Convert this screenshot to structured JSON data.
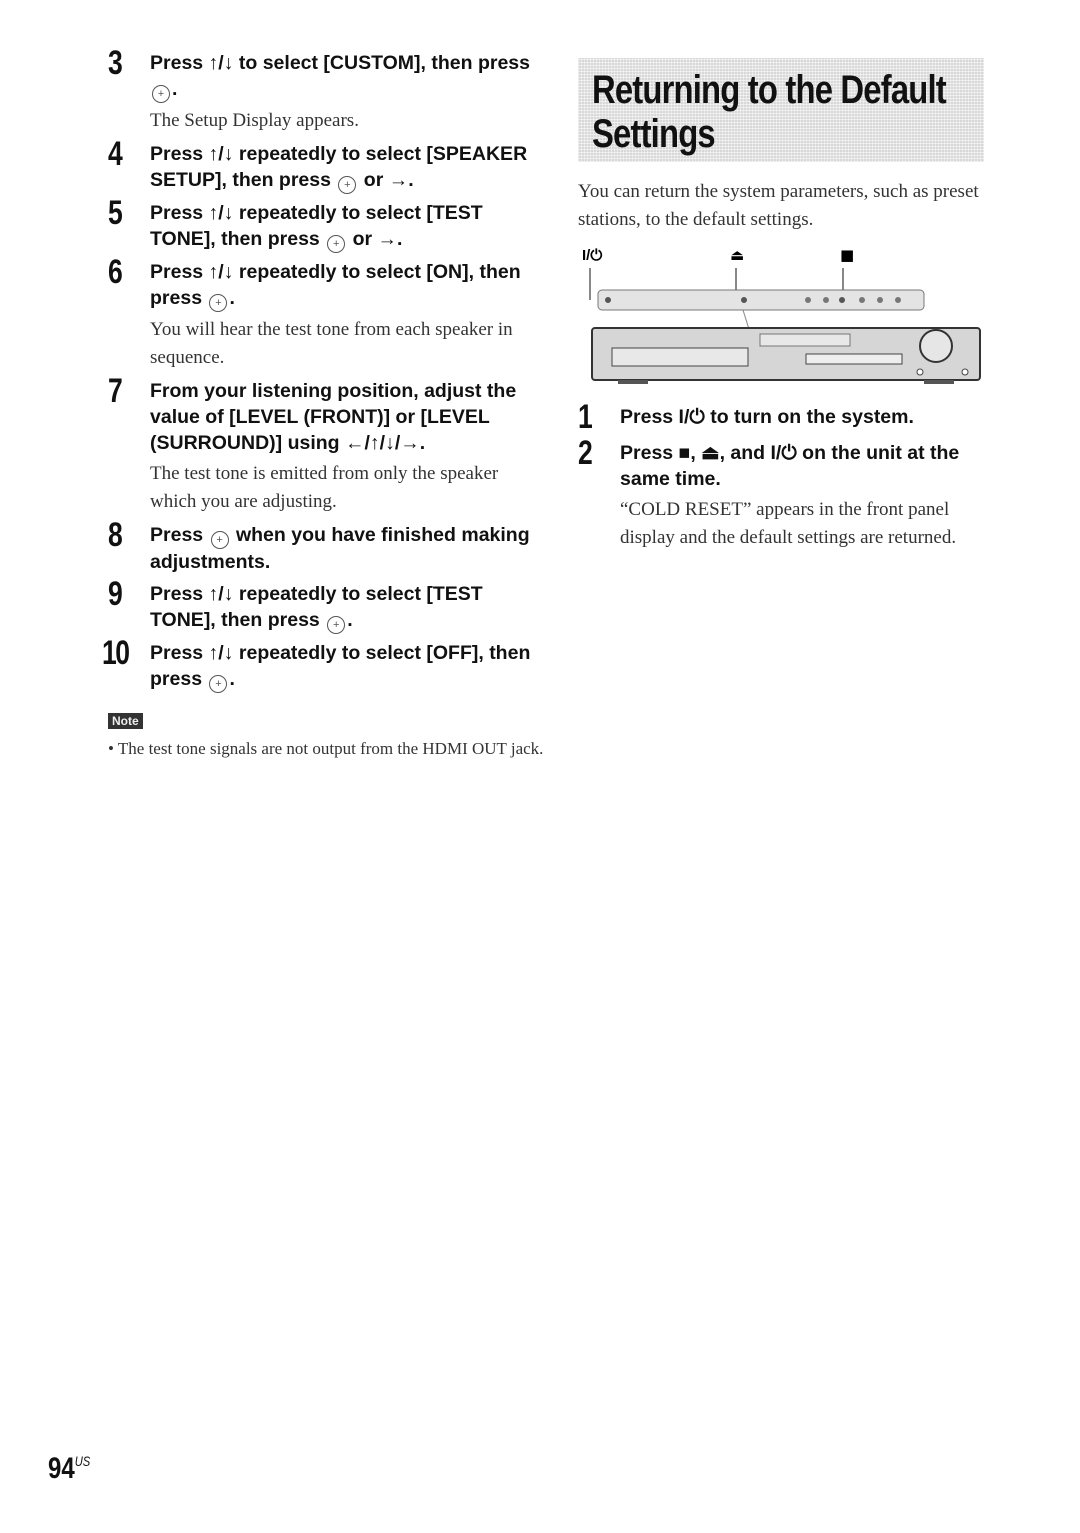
{
  "left_steps": [
    {
      "num": "3",
      "title_a": "Press ↑/↓ to select [CUSTOM], then press ",
      "title_b": ".",
      "body": "The Setup Display appears."
    },
    {
      "num": "4",
      "title_a": "Press ↑/↓ repeatedly to select [SPEAKER SETUP], then press ",
      "title_b": " or →.",
      "body": ""
    },
    {
      "num": "5",
      "title_a": "Press ↑/↓ repeatedly to select [TEST TONE], then press ",
      "title_b": " or →.",
      "body": ""
    },
    {
      "num": "6",
      "title_a": "Press ↑/↓ repeatedly to select [ON], then press ",
      "title_b": ".",
      "body": "You will hear the test tone from each speaker in sequence."
    },
    {
      "num": "7",
      "title_a": "From your listening position, adjust the value of [LEVEL (FRONT)] or [LEVEL (SURROUND)] using ←/↑/↓/→.",
      "title_b": "",
      "body": "The test tone is emitted from only the speaker which you are adjusting."
    },
    {
      "num": "8",
      "title_a": "Press ",
      "title_b": " when you have finished making adjustments.",
      "body": ""
    },
    {
      "num": "9",
      "title_a": "Press ↑/↓ repeatedly to select [TEST TONE], then press ",
      "title_b": ".",
      "body": ""
    },
    {
      "num": "10",
      "title_a": "Press ↑/↓ repeatedly to select [OFF], then press ",
      "title_b": ".",
      "body": ""
    }
  ],
  "note": {
    "badge": "Note",
    "text": "• The test tone signals are not output from the HDMI OUT jack."
  },
  "section": {
    "heading_line1": "Returning to the Default",
    "heading_line2": "Settings",
    "intro": "You can return the system parameters, such as preset stations, to the default settings."
  },
  "device_labels": {
    "power": "I/⏻",
    "eject": "⏏",
    "stop": "■"
  },
  "right_steps": [
    {
      "num": "1",
      "title": "Press I/⏻ to turn on the system.",
      "body": ""
    },
    {
      "num": "2",
      "title": "Press ■, ⏏, and I/⏻ on the unit at the same time.",
      "body": "“COLD RESET” appears in the front panel display and the default settings are returned."
    }
  ],
  "page": {
    "number": "94",
    "suffix": "US"
  },
  "enter_glyph": "+"
}
